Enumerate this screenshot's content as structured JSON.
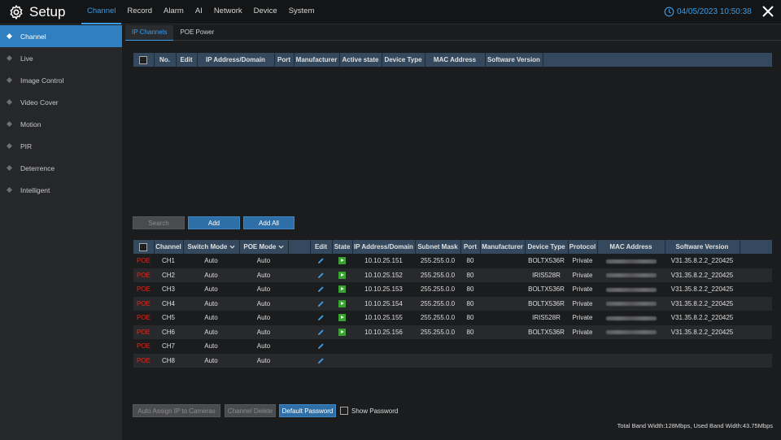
{
  "app": {
    "title": "Setup"
  },
  "nav": [
    "Channel",
    "Record",
    "Alarm",
    "AI",
    "Network",
    "Device",
    "System"
  ],
  "datetime": "04/05/2023 10:50:38",
  "sidebar": [
    "Channel",
    "Live",
    "Image Control",
    "Video Cover",
    "Motion",
    "PIR",
    "Deterrence",
    "Intelligent"
  ],
  "subtabs": [
    "IP Channels",
    "POE Power"
  ],
  "ip_table": {
    "headers": [
      "No.",
      "Edit",
      "IP Address/Domain",
      "Port",
      "Manufacturer",
      "Active state",
      "Device Type",
      "MAC Address",
      "Software Version"
    ]
  },
  "mid_buttons": {
    "search": "Search",
    "add": "Add",
    "add_all": "Add All"
  },
  "channel_table": {
    "headers": [
      "Channel",
      "Switch Mode",
      "POE Mode",
      "Edit",
      "State",
      "IP Address/Domain",
      "Subnet Mask",
      "Port",
      "Manufacturer",
      "Device Type",
      "Protocol",
      "MAC Address",
      "Software Version"
    ],
    "rows": [
      {
        "poe": "POE",
        "channel": "CH1",
        "switch": "Auto",
        "poe_mode": "Auto",
        "ip": "10.10.25.151",
        "mask": "255.255.0.0",
        "port": "80",
        "type": "BOLTX536R",
        "protocol": "Private",
        "version": "V31.35.8.2.2_220425"
      },
      {
        "poe": "POE",
        "channel": "CH2",
        "switch": "Auto",
        "poe_mode": "Auto",
        "ip": "10.10.25.152",
        "mask": "255.255.0.0",
        "port": "80",
        "type": "IRIS528R",
        "protocol": "Private",
        "version": "V31.35.8.2.2_220425"
      },
      {
        "poe": "POE",
        "channel": "CH3",
        "switch": "Auto",
        "poe_mode": "Auto",
        "ip": "10.10.25.153",
        "mask": "255.255.0.0",
        "port": "80",
        "type": "BOLTX536R",
        "protocol": "Private",
        "version": "V31.35.8.2.2_220425"
      },
      {
        "poe": "POE",
        "channel": "CH4",
        "switch": "Auto",
        "poe_mode": "Auto",
        "ip": "10.10.25.154",
        "mask": "255.255.0.0",
        "port": "80",
        "type": "BOLTX536R",
        "protocol": "Private",
        "version": "V31.35.8.2.2_220425"
      },
      {
        "poe": "POE",
        "channel": "CH5",
        "switch": "Auto",
        "poe_mode": "Auto",
        "ip": "10.10.25.155",
        "mask": "255.255.0.0",
        "port": "80",
        "type": "IRIS528R",
        "protocol": "Private",
        "version": "V31.35.8.2.2_220425"
      },
      {
        "poe": "POE",
        "channel": "CH6",
        "switch": "Auto",
        "poe_mode": "Auto",
        "ip": "10.10.25.156",
        "mask": "255.255.0.0",
        "port": "80",
        "type": "BOLTX536R",
        "protocol": "Private",
        "version": "V31.35.8.2.2_220425"
      },
      {
        "poe": "POE",
        "channel": "CH7",
        "switch": "Auto",
        "poe_mode": "Auto",
        "ip": "",
        "mask": "",
        "port": "",
        "type": "",
        "protocol": "",
        "version": ""
      },
      {
        "poe": "POE",
        "channel": "CH8",
        "switch": "Auto",
        "poe_mode": "Auto",
        "ip": "",
        "mask": "",
        "port": "",
        "type": "",
        "protocol": "",
        "version": ""
      }
    ]
  },
  "bottom_buttons": {
    "auto_assign": "Auto Assign IP to Cameras",
    "channel_delete": "Channel Delete",
    "default_password": "Default Password",
    "show_password": "Show Password"
  },
  "bandwidth": "Total Band Width:128Mbps, Used Band Width:43.75Mbps",
  "colors": {
    "accent": "#3b9ce6",
    "poe": "#e0281e",
    "state_on": "#3aa132"
  }
}
